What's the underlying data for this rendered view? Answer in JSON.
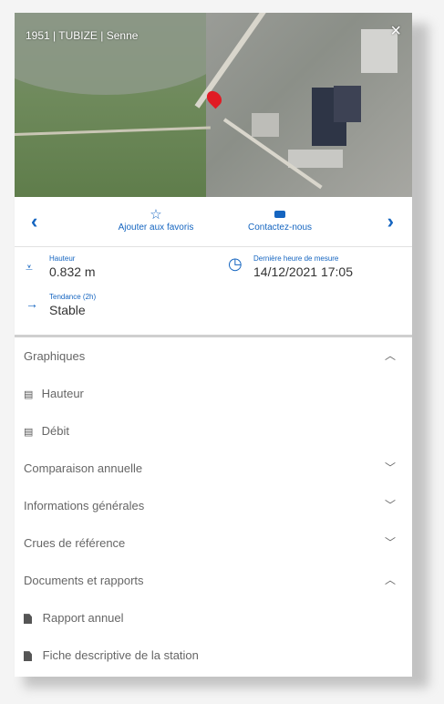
{
  "station": {
    "title": "1951 | TUBIZE | Senne",
    "close_symbol": "×"
  },
  "actions": {
    "prev_symbol": "‹",
    "next_symbol": "›",
    "favorites_label": "Ajouter aux favoris",
    "contact_label": "Contactez-nous"
  },
  "measurements": {
    "height_label": "Hauteur",
    "height_value": "0.832 m",
    "last_measure_label": "Dernière heure de mesure",
    "last_measure_value": "14/12/2021 17:05",
    "trend_label": "Tendance (2h)",
    "trend_value": "Stable"
  },
  "sections": {
    "graphics": {
      "label": "Graphiques",
      "state": "expanded"
    },
    "graphics_items": [
      "Hauteur",
      "Débit"
    ],
    "annual": {
      "label": "Comparaison annuelle",
      "state": "collapsed"
    },
    "general": {
      "label": "Informations générales",
      "state": "collapsed"
    },
    "floods": {
      "label": "Crues de référence",
      "state": "collapsed"
    },
    "docs": {
      "label": "Documents et rapports",
      "state": "expanded"
    },
    "docs_items": [
      "Rapport annuel",
      "Fiche descriptive de la station"
    ]
  },
  "colors": {
    "accent": "#1565c0",
    "pin": "#e01b24"
  }
}
